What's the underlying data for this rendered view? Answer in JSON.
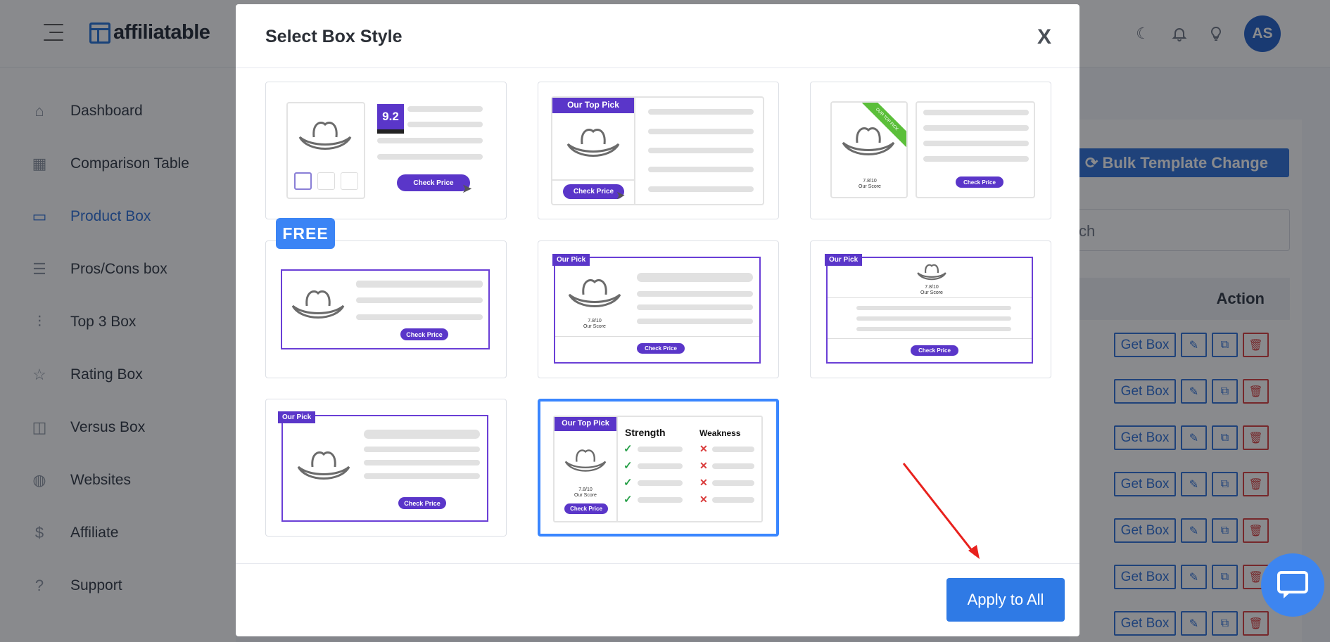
{
  "app": {
    "brand": "affiliatable",
    "avatar_initials": "AS",
    "accent": "#2a6fd8"
  },
  "topbar": {
    "icons": [
      "moon-icon",
      "bell-icon",
      "lightbulb-icon"
    ]
  },
  "sidebar": {
    "items": [
      {
        "label": "Dashboard",
        "icon": "home-icon"
      },
      {
        "label": "Comparison Table",
        "icon": "table-icon"
      },
      {
        "label": "Product Box",
        "icon": "card-icon",
        "active": true
      },
      {
        "label": "Pros/Cons box",
        "icon": "list-icon"
      },
      {
        "label": "Top 3 Box",
        "icon": "sliders-icon"
      },
      {
        "label": "Rating Box",
        "icon": "star-icon"
      },
      {
        "label": "Versus Box",
        "icon": "columns-icon"
      },
      {
        "label": "Websites",
        "icon": "globe-icon"
      },
      {
        "label": "Affiliate",
        "icon": "dollar-icon"
      },
      {
        "label": "Support",
        "icon": "help-icon"
      }
    ]
  },
  "main": {
    "bulk_button": "Bulk Template Change",
    "search_placeholder_visible": "ch",
    "action_header": "Action",
    "row_button": "Get Box",
    "row_count": 7
  },
  "modal": {
    "title": "Select Box Style",
    "close_label": "X",
    "apply_button": "Apply to All",
    "free_badge": "FREE",
    "previews": {
      "score_1": "9.2",
      "check_price": "Check Price",
      "our_top_pick": "Our Top Pick",
      "our_pick": "Our Pick",
      "score_text": "7.8/10",
      "score_sub": "Our Score",
      "ribbon": "OUR TOP PICK",
      "strength": "Strength",
      "weakness": "Weakness"
    },
    "selected_index": 7
  }
}
